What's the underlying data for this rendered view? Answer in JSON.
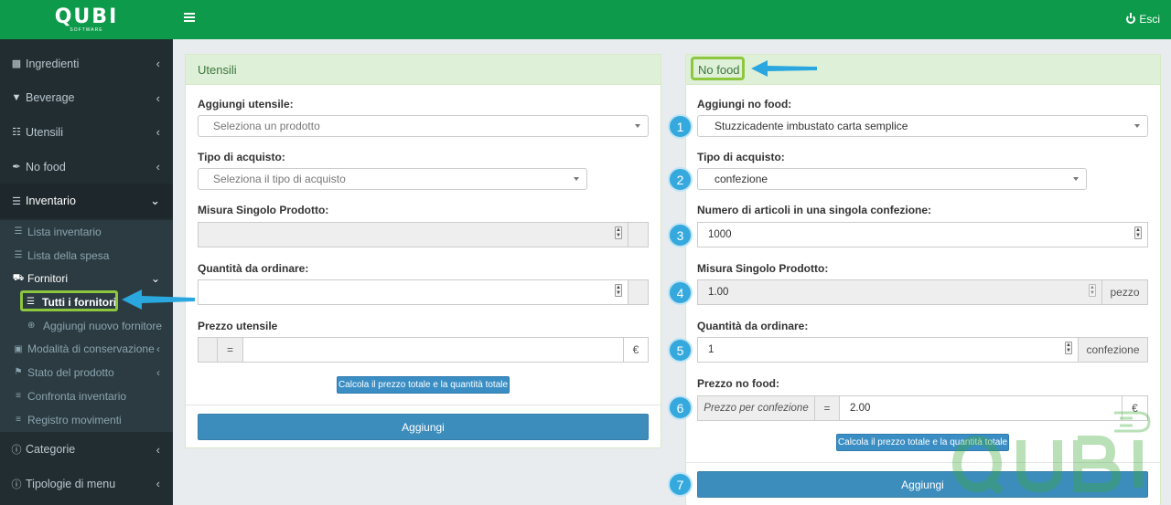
{
  "app": {
    "brand": "QUBI",
    "brand_sub": "SOFTWARE",
    "logout_label": "Esci"
  },
  "sidebar": {
    "items": [
      {
        "label": "Ingredienti",
        "icon": "sitemap-icon"
      },
      {
        "label": "Beverage",
        "icon": "cocktail-icon"
      },
      {
        "label": "Utensili",
        "icon": "cutlery-icon"
      },
      {
        "label": "No food",
        "icon": "wrench-icon"
      },
      {
        "label": "Inventario",
        "icon": "list-icon"
      }
    ],
    "inventario_sub": [
      {
        "label": "Lista inventario",
        "icon": "list-icon"
      },
      {
        "label": "Lista della spesa",
        "icon": "list-ol-icon"
      },
      {
        "label": "Fornitori",
        "icon": "truck-icon"
      }
    ],
    "fornitori_sub": [
      {
        "label": "Tutti i fornitori",
        "icon": "list-icon"
      },
      {
        "label": "Aggiungi nuovo fornitore",
        "icon": "plus-circle-icon"
      }
    ],
    "inventario_sub2": [
      {
        "label": "Modalità di conservazione",
        "icon": "cube-icon"
      },
      {
        "label": "Stato del prodotto",
        "icon": "flag-icon"
      },
      {
        "label": "Confronta inventario",
        "icon": "bars-icon"
      },
      {
        "label": "Registro movimenti",
        "icon": "bars-icon"
      }
    ],
    "bottom": [
      {
        "label": "Categorie",
        "icon": "info-icon"
      },
      {
        "label": "Tipologie di menu",
        "icon": "info-icon"
      }
    ]
  },
  "utensili": {
    "title": "Utensili",
    "add_label": "Aggiungi utensile:",
    "add_placeholder": "Seleziona un prodotto",
    "tipo_label": "Tipo di acquisto:",
    "tipo_placeholder": "Seleziona il tipo di acquisto",
    "misura_label": "Misura Singolo Prodotto:",
    "quantita_label": "Quantità da ordinare:",
    "prezzo_label": "Prezzo utensile",
    "equals": "=",
    "euro": "€",
    "calc_button": "Calcola il prezzo totale e la quantità totale",
    "add_button": "Aggiungi"
  },
  "nofood": {
    "title": "No food",
    "add_label": "Aggiungi no food:",
    "add_value": "Stuzzicadente imbustato carta semplice",
    "tipo_label": "Tipo di acquisto:",
    "tipo_value": "confezione",
    "articoli_label": "Numero di articoli in una singola confezione:",
    "articoli_value": "1000",
    "misura_label": "Misura Singolo Prodotto:",
    "misura_value": "1.00",
    "misura_unit": "pezzo",
    "quantita_label": "Quantità da ordinare:",
    "quantita_value": "1",
    "quantita_unit": "confezione",
    "prezzo_label": "Prezzo no food:",
    "prezzo_per": "Prezzo per confezione",
    "equals": "=",
    "prezzo_value": "2.00",
    "euro": "€",
    "calc_button": "Calcola il prezzo totale e la quantità totale",
    "add_button": "Aggiungi"
  },
  "steps": [
    "1",
    "2",
    "3",
    "4",
    "5",
    "6",
    "7"
  ],
  "colors": {
    "accent_green": "#0d9a4a",
    "sidebar_bg": "#222d32",
    "highlight": "#8dc63f",
    "arrow_blue": "#2aa7de",
    "button_blue": "#3c8dbc"
  }
}
